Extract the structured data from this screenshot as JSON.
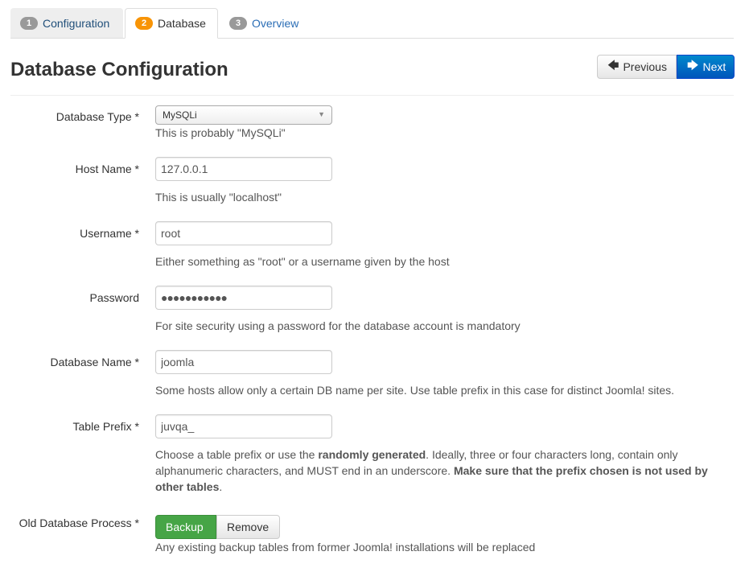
{
  "tabs": [
    {
      "num": "1",
      "label": "Configuration",
      "badge_color": "#999999"
    },
    {
      "num": "2",
      "label": "Database",
      "badge_color": "#f89406"
    },
    {
      "num": "3",
      "label": "Overview",
      "badge_color": "#999999"
    }
  ],
  "page_title": "Database Configuration",
  "buttons": {
    "previous": "Previous",
    "previous_icon": "arrow-left-icon",
    "next": "Next",
    "next_icon": "arrow-right-icon"
  },
  "form": {
    "db_type": {
      "label": "Database Type *",
      "value": "MySQLi",
      "help": "This is probably \"MySQLi\""
    },
    "host": {
      "label": "Host Name *",
      "value": "127.0.0.1",
      "help": "This is usually \"localhost\""
    },
    "username": {
      "label": "Username *",
      "value": "root",
      "help": "Either something as \"root\" or a username given by the host"
    },
    "password": {
      "label": "Password",
      "value": "●●●●●●●●●●●",
      "help": "For site security using a password for the database account is mandatory"
    },
    "db_name": {
      "label": "Database Name *",
      "value": "joomla",
      "help": "Some hosts allow only a certain DB name per site. Use table prefix in this case for distinct Joomla! sites."
    },
    "prefix": {
      "label": "Table Prefix *",
      "value": "juvqa_",
      "help_1": "Choose a table prefix or use the ",
      "help_bold_1": "randomly generated",
      "help_2": ". Ideally, three or four characters long, contain only alphanumeric characters, and MUST end in an underscore. ",
      "help_bold_2": "Make sure that the prefix chosen is not used by other tables",
      "help_3": "."
    },
    "old_db": {
      "label": "Old Database Process *",
      "backup": "Backup",
      "remove": "Remove",
      "selected": "Backup",
      "help": "Any existing backup tables from former Joomla! installations will be replaced"
    }
  },
  "colors": {
    "accent": "#0055bb",
    "success": "#46a546",
    "active_step": "#f89406"
  }
}
